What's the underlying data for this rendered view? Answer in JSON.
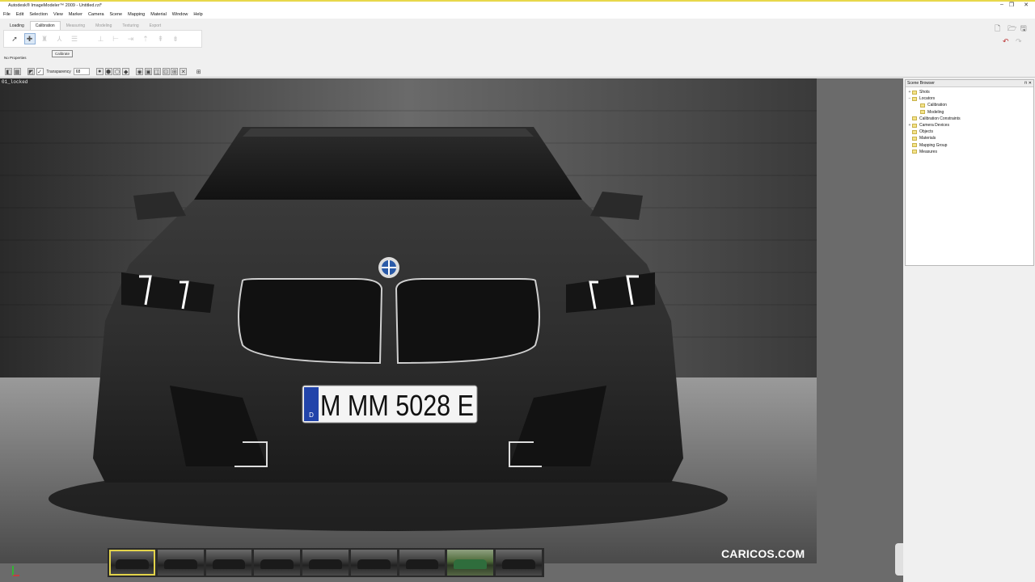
{
  "app": {
    "title": "Autodesk® ImageModeler™ 2009 - Untitled.rzi*",
    "window_controls": [
      "–",
      "❐",
      "✕"
    ]
  },
  "menu": [
    "File",
    "Edit",
    "Selection",
    "View",
    "Marker",
    "Camera",
    "Scene",
    "Mapping",
    "Material",
    "Window",
    "Help"
  ],
  "tabs": [
    "Loading",
    "Calibration",
    "Measuring",
    "Modeling",
    "Texturing",
    "Export"
  ],
  "active_tab": "Calibration",
  "tooltip": "Calibrate",
  "properties": "No Properties",
  "viewbar": {
    "transparency_label": "Transparency",
    "transparency_value": "68"
  },
  "view_name": "01_locked",
  "watermark": "CARICOS.COM",
  "plate": {
    "text": "M MM 5028 E",
    "country": "D"
  },
  "scene_browser": {
    "title": "Scene Browser",
    "items": [
      {
        "label": "Shots",
        "level": 0,
        "toggle": "+"
      },
      {
        "label": "Locators",
        "level": 0,
        "toggle": "−"
      },
      {
        "label": "Calibration",
        "level": 1,
        "toggle": ""
      },
      {
        "label": "Modeling",
        "level": 1,
        "toggle": ""
      },
      {
        "label": "Calibration Constraints",
        "level": 0,
        "toggle": ""
      },
      {
        "label": "Camera Devices",
        "level": 0,
        "toggle": "+"
      },
      {
        "label": "Objects",
        "level": 0,
        "toggle": ""
      },
      {
        "label": "Materials",
        "level": 0,
        "toggle": ""
      },
      {
        "label": "Mapping Group",
        "level": 0,
        "toggle": ""
      },
      {
        "label": "Measures",
        "level": 0,
        "toggle": ""
      }
    ]
  },
  "filmstrip": {
    "count": 9,
    "selected_index": 0,
    "green_index": 7
  },
  "colors": {
    "accent": "#e2d34a",
    "viewport_bg": "#6b6b6b"
  }
}
